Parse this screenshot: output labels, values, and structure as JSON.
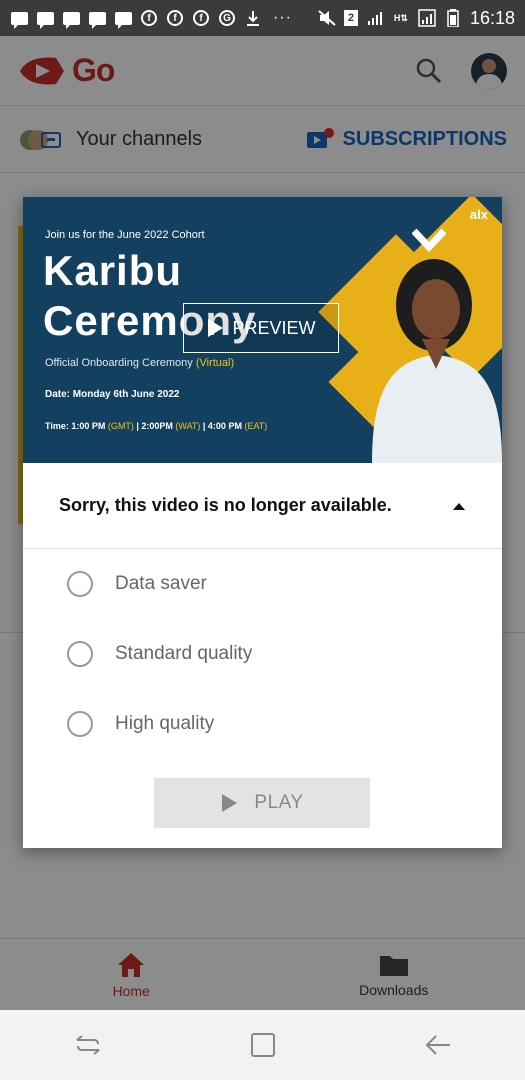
{
  "status_bar": {
    "notification_icons": [
      "message-icon",
      "message-icon",
      "message-icon",
      "message-icon",
      "message-icon",
      "facebook-icon",
      "facebook-icon",
      "facebook-icon",
      "google-icon",
      "download-icon"
    ],
    "more": "···",
    "sim_badge": "2",
    "time": "16:18"
  },
  "app_bar": {
    "logo_text": "Go",
    "brand_color": "#c4302b"
  },
  "channels_bar": {
    "your_channels_label": "Your channels",
    "subscriptions_label": "SUBSCRIPTIONS",
    "subscriptions_color": "#1565c0"
  },
  "dialog": {
    "thumbnail": {
      "join_text": "Join us for the June 2022 Cohort",
      "title_line1": "Karibu",
      "title_line2": "Ceremony",
      "subtitle_main": "Official Onboarding Ceremony",
      "subtitle_accent": "(Virtual)",
      "date_text": "Date: Monday 6th June 2022",
      "time_parts": [
        "Time: 1:00 PM ",
        "(GMT)",
        " | 2:00PM ",
        "(WAT)",
        " | 4:00 PM ",
        "(EAT)"
      ],
      "brand": "alx",
      "preview_label": "PREVIEW"
    },
    "message": "Sorry, this video is no longer available.",
    "options": [
      {
        "label": "Data saver",
        "selected": false
      },
      {
        "label": "Standard quality",
        "selected": false
      },
      {
        "label": "High quality",
        "selected": false
      }
    ],
    "play_label": "PLAY"
  },
  "bottom_nav": {
    "home_label": "Home",
    "downloads_label": "Downloads"
  }
}
